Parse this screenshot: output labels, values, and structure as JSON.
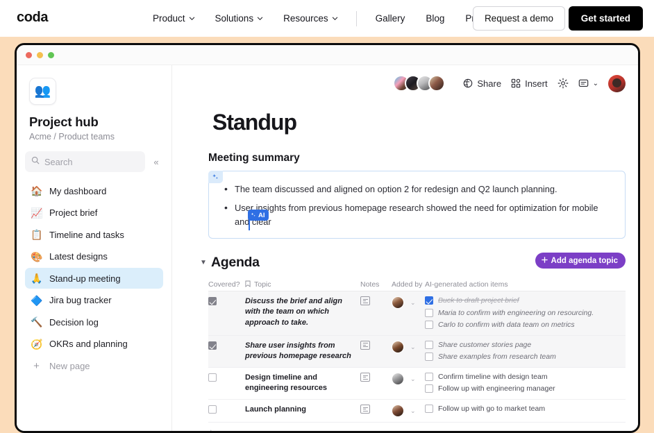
{
  "topnav": {
    "brand": "coda",
    "menus": [
      {
        "label": "Product",
        "has_caret": true
      },
      {
        "label": "Solutions",
        "has_caret": true
      },
      {
        "label": "Resources",
        "has_caret": true
      }
    ],
    "links": [
      {
        "label": "Gallery"
      },
      {
        "label": "Blog"
      },
      {
        "label": "Pricing"
      }
    ],
    "demo_button": "Request a demo",
    "start_button": "Get started"
  },
  "window": {
    "traffic_lights": [
      "close-red",
      "minimize-yellow",
      "maximize-green"
    ],
    "backdrop_color": "#fbdcba"
  },
  "sidebar": {
    "workspace_icon": "👥",
    "title": "Project hub",
    "breadcrumb": "Acme / Product teams",
    "search": {
      "placeholder": "Search",
      "value": ""
    },
    "collapse_icon": "«",
    "items": [
      {
        "icon": "🏠",
        "label": "My dashboard",
        "active": false
      },
      {
        "icon": "📈",
        "label": "Project brief",
        "active": false
      },
      {
        "icon": "📋",
        "label": "Timeline and tasks",
        "active": false
      },
      {
        "icon": "🎨",
        "label": "Latest designs",
        "active": false
      },
      {
        "icon": "🙏",
        "label": "Stand-up meeting",
        "active": true
      },
      {
        "icon": "🔷",
        "label": "Jira bug tracker",
        "active": false
      },
      {
        "icon": "🔨",
        "label": "Decision log",
        "active": false
      },
      {
        "icon": "🧭",
        "label": "OKRs and planning",
        "active": false
      }
    ],
    "new_page": {
      "icon": "+",
      "label": "New page"
    }
  },
  "doc_toolbar": {
    "collaborators": 4,
    "share_label": "Share",
    "insert_label": "Insert",
    "settings_icon": "gear-icon",
    "comment_icon": "comment-icon",
    "comment_caret": "⌄"
  },
  "doc": {
    "title": "Standup",
    "summary_heading": "Meeting summary",
    "summary_bullets": [
      "The team discussed and aligned on option 2 for redesign and Q2 launch planning.",
      "User insights from previous homepage research showed the need for optimization for mobile and clear"
    ],
    "ai_pill_label": "AI",
    "ai_corner_icon": "sparkles-icon"
  },
  "agenda": {
    "title": "Agenda",
    "collapse_triangle": "▼",
    "add_button": "Add agenda topic",
    "add_button_color": "#7c3fc6",
    "columns": [
      "Covered?",
      "Topic",
      "Notes",
      "Added by",
      "AI-generated action items"
    ],
    "topic_column_icon": "bookmark-icon",
    "rows": [
      {
        "covered": true,
        "topic": "Discuss the brief and align with the team on which approach to take.",
        "italic": true,
        "shaded": true,
        "notes_icon": "note-icon",
        "action_items": [
          {
            "checked": true,
            "text": "Buck to draft project brief",
            "done": true
          },
          {
            "checked": false,
            "text": "Maria to confirm with engineering on resourcing.",
            "done": false
          },
          {
            "checked": false,
            "text": "Carlo to confirm with data team on metrics",
            "done": false
          }
        ]
      },
      {
        "covered": true,
        "topic": "Share user insights from previous homepage research",
        "italic": true,
        "shaded": true,
        "notes_icon": "note-icon",
        "action_items": [
          {
            "checked": false,
            "text": "Share customer stories page",
            "done": false
          },
          {
            "checked": false,
            "text": "Share examples from research team",
            "done": false
          }
        ]
      },
      {
        "covered": false,
        "topic": "Design timeline and engineering resources",
        "italic": false,
        "shaded": false,
        "notes_icon": "note-icon",
        "action_items": [
          {
            "checked": false,
            "text": "Confirm timeline with design team",
            "done": false
          },
          {
            "checked": false,
            "text": "Follow up with engineering manager",
            "done": false
          }
        ]
      },
      {
        "covered": false,
        "topic": "Launch planning",
        "italic": false,
        "shaded": false,
        "notes_icon": "note-icon",
        "action_items": [
          {
            "checked": false,
            "text": "Follow up with go to market team",
            "done": false
          }
        ]
      }
    ],
    "add_row_icon": "+"
  }
}
